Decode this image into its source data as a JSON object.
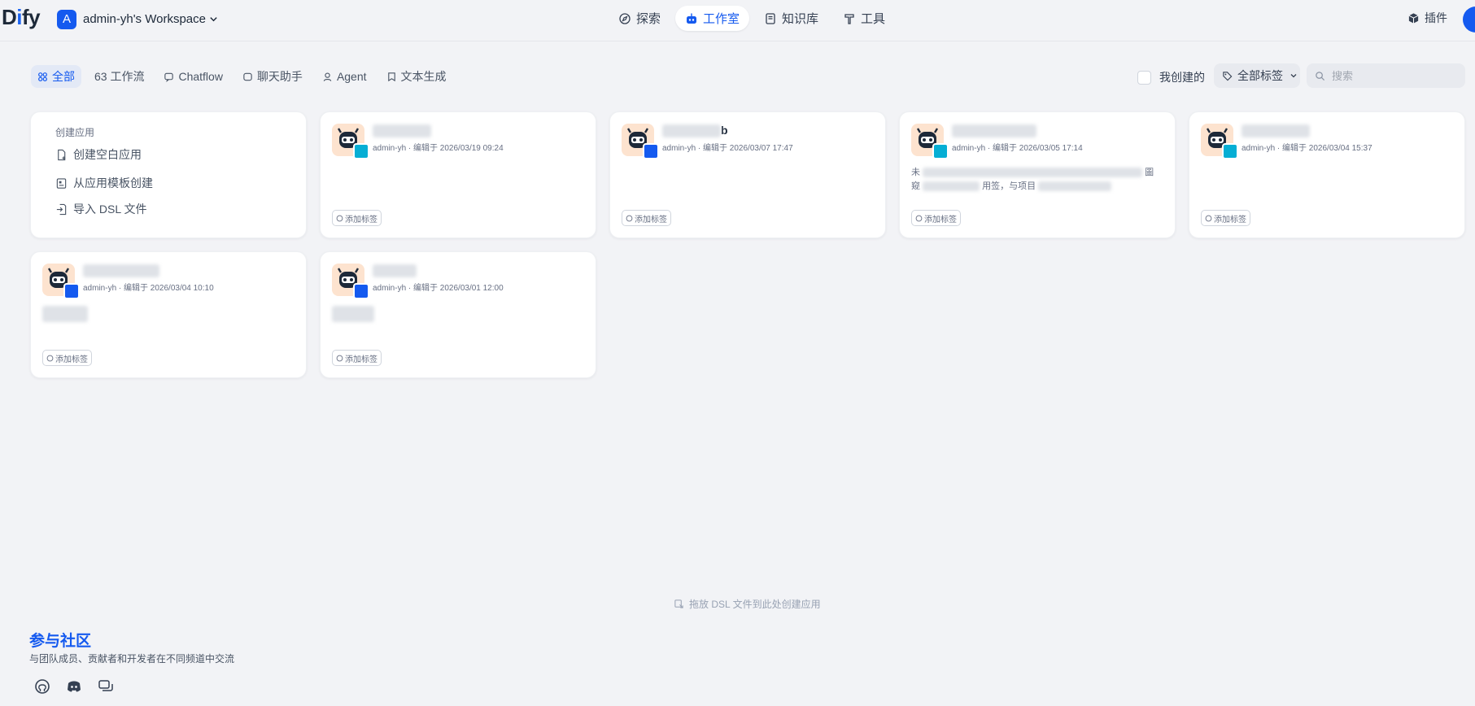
{
  "brand": {
    "logo_prefix": "D",
    "logo_highlight": "i",
    "logo_suffix": "fy"
  },
  "workspace": {
    "avatar_letter": "A",
    "name": "admin-yh's Workspace"
  },
  "nav": {
    "tabs": [
      {
        "label": "探索",
        "icon": "compass-icon",
        "active": false
      },
      {
        "label": "工作室",
        "icon": "robot-icon",
        "active": true
      },
      {
        "label": "知识库",
        "icon": "book-icon",
        "active": false
      },
      {
        "label": "工具",
        "icon": "hammer-icon",
        "active": false
      }
    ],
    "plugin_label": "插件"
  },
  "filters": {
    "tabs": [
      {
        "label": "全部",
        "icon": "grid-icon",
        "active": true
      },
      {
        "label": "63 工作流",
        "icon": "",
        "active": false
      },
      {
        "label": "Chatflow",
        "icon": "chat-bubble-icon",
        "active": false
      },
      {
        "label": "聊天助手",
        "icon": "chat-square-icon",
        "active": false
      },
      {
        "label": "Agent",
        "icon": "agent-icon",
        "active": false
      },
      {
        "label": "文本生成",
        "icon": "text-doc-icon",
        "active": false
      }
    ],
    "mine_label": "我创建的",
    "tag_select_label": "全部标签",
    "search_placeholder": "搜索"
  },
  "create": {
    "title": "创建应用",
    "items": [
      {
        "label": "创建空白应用",
        "icon": "file-plus-icon"
      },
      {
        "label": "从应用模板创建",
        "icon": "template-icon"
      },
      {
        "label": "导入 DSL 文件",
        "icon": "import-icon"
      }
    ]
  },
  "apps": [
    {
      "name_visible": "",
      "meta": "admin-yh · 编辑于 2026/03/19 09:24",
      "desc": "",
      "type": "workflow",
      "tag_label": "添加标签"
    },
    {
      "name_visible": "b",
      "meta": "admin-yh · 编辑于 2026/03/07 17:47",
      "desc": "",
      "type": "chat",
      "tag_label": "添加标签"
    },
    {
      "name_visible": "",
      "meta": "admin-yh · 编辑于 2026/03/05 17:14",
      "desc_line1_start": "未",
      "desc_line1_end": "圖",
      "desc_line2_start": "窥",
      "desc_line2_mid": "用签，与项目",
      "type": "workflow",
      "tag_label": "添加标签"
    },
    {
      "name_visible": "",
      "meta": "admin-yh · 编辑于 2026/03/04 15:37",
      "desc": "",
      "type": "workflow",
      "tag_label": "添加标签"
    },
    {
      "name_visible": "",
      "meta": "admin-yh · 编辑于 2026/03/04 10:10",
      "desc": "",
      "type": "chat",
      "tag_label": "添加标签"
    },
    {
      "name_visible": "",
      "meta": "admin-yh · 编辑于 2026/03/01 12:00",
      "desc": "",
      "type": "chat",
      "tag_label": "添加标签"
    }
  ],
  "footer": {
    "drop_hint": "拖放 DSL 文件到此处创建应用",
    "community_title": "参与社区",
    "community_sub": "与团队成员、贡献者和开发者在不同频道中交流",
    "social": [
      "github-icon",
      "discord-icon",
      "forum-icon"
    ]
  }
}
